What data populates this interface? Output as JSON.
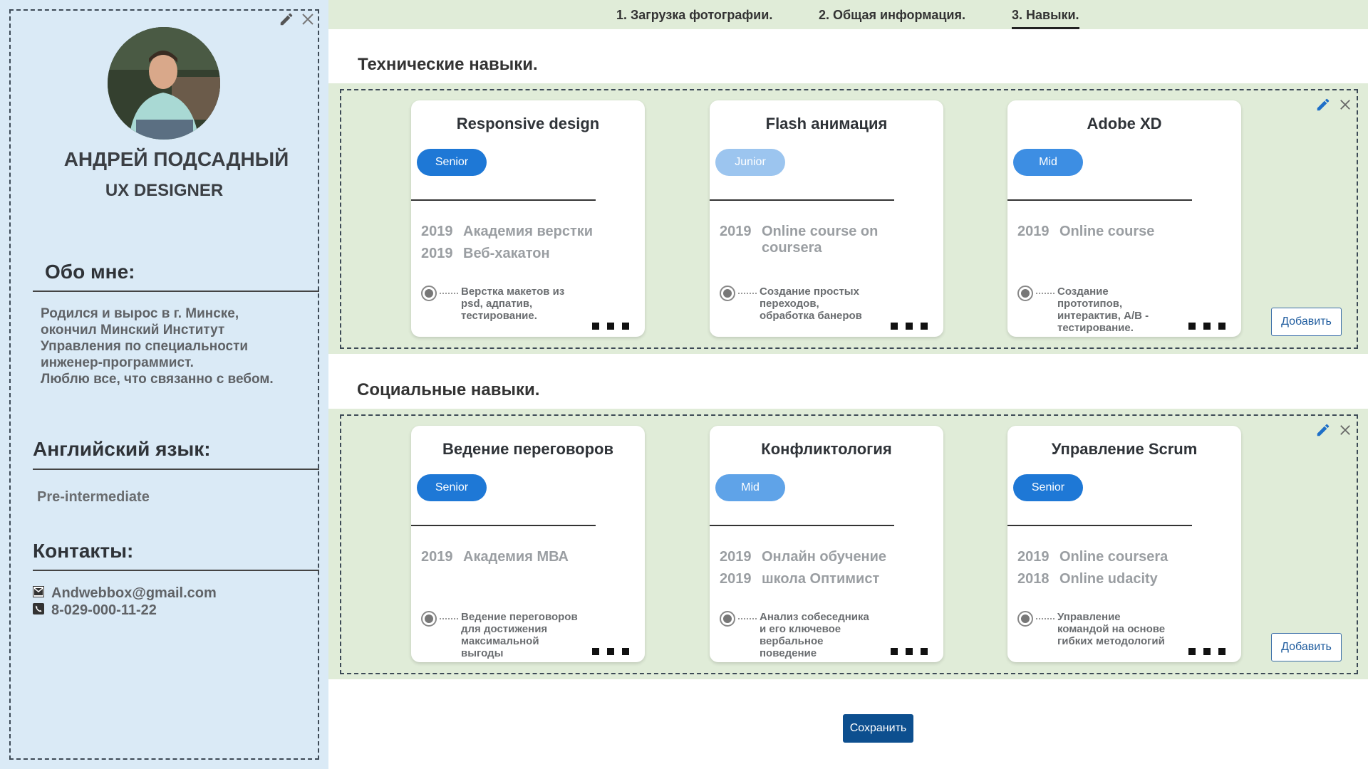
{
  "profile": {
    "name": "АНДРЕЙ ПОДСАДНЫЙ",
    "role": "UX DESIGNER",
    "about_heading": "Обо мне:",
    "about_text": "Родился и вырос в  г. Минске,\nокончил Минский Институт\nУправления по специальности\nинженер-программист.\nЛюблю все, что связанно с вебом.",
    "english_heading": "Английский язык:",
    "english_level": "Pre-intermediate",
    "contacts_heading": "Контакты:",
    "email": "Andwebbox@gmail.com",
    "phone": "8-029-000-11-22"
  },
  "steps": [
    {
      "label": "1. Загрузка фотографии."
    },
    {
      "label": "2. Общая информация."
    },
    {
      "label": "3. Навыки."
    }
  ],
  "active_step": 3,
  "colors": {
    "senior": "#1e78d6",
    "mid_strong": "#3d8ee3",
    "mid_light": "#5fa3e8",
    "junior": "#9cc5ef",
    "band_bg": "#e0ecd8",
    "sidebar_bg": "#daeaf6",
    "save_bg": "#0d4f8f"
  },
  "technical": {
    "title": "Технические навыки.",
    "add_label": "Добавить",
    "cards": [
      {
        "title": "Responsive design",
        "level": "Senior",
        "edu": [
          {
            "year": "2019",
            "name": "Академия верстки"
          },
          {
            "year": "2019",
            "name": "Веб-хакатон"
          }
        ],
        "desc": "Верстка макетов из psd, адпатив, тестирование."
      },
      {
        "title": "Flash анимация",
        "level": "Junior",
        "edu": [
          {
            "year": "2019",
            "name": "Online course on coursera"
          }
        ],
        "desc": "Создание простых переходов, обработка банеров"
      },
      {
        "title": "Adobe XD",
        "level": "Mid",
        "edu": [
          {
            "year": "2019",
            "name": "Online course"
          }
        ],
        "desc": "Создание прототипов, интерактив, A/B - тестирование."
      }
    ]
  },
  "social": {
    "title": "Социальные навыки.",
    "add_label": "Добавить",
    "cards": [
      {
        "title": "Ведение переговоров",
        "level": "Senior",
        "edu": [
          {
            "year": "2019",
            "name": "Академия МВА"
          }
        ],
        "desc": "Ведение переговоров для достижения максимальной выгоды"
      },
      {
        "title": "Конфликтология",
        "level": "Mid",
        "edu": [
          {
            "year": "2019",
            "name": "Онлайн обучение"
          },
          {
            "year": "2019",
            "name": "школа Оптимист"
          }
        ],
        "desc": "Анализ собеседника и его ключевое вербальное поведение"
      },
      {
        "title": "Управление Scrum",
        "level": "Senior",
        "edu": [
          {
            "year": "2019",
            "name": "Online coursera"
          },
          {
            "year": "2018",
            "name": "Online udacity"
          }
        ],
        "desc": "Управление командой на основе гибких методологий"
      }
    ]
  },
  "icons": {
    "edit": "pencil-icon",
    "close": "close-icon",
    "email": "envelope-icon",
    "phone": "phone-icon"
  },
  "save_label": "Сохранить"
}
